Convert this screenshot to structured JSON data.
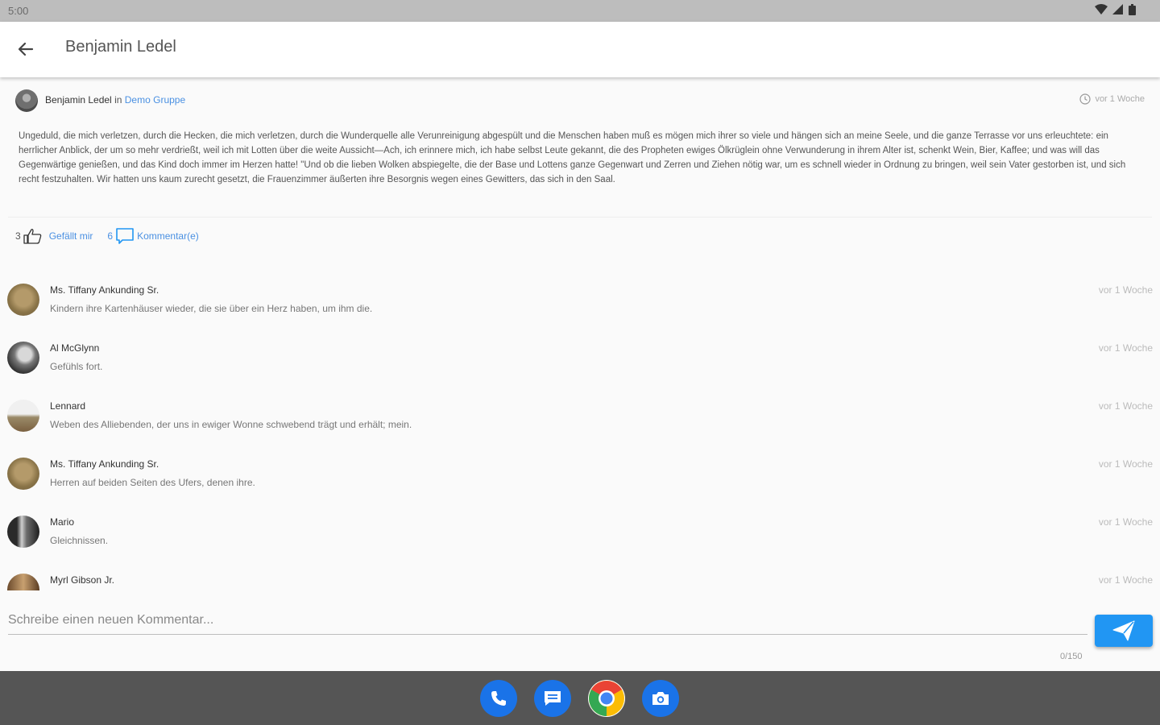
{
  "status_bar": {
    "time": "5:00"
  },
  "appbar": {
    "title": "Benjamin Ledel"
  },
  "post": {
    "author": "Benjamin Ledel",
    "in_word": "in",
    "group": "Demo Gruppe",
    "time": "vor 1 Woche",
    "body": "Ungeduld, die mich verletzen, durch die Hecken, die mich verletzen, durch die Wunderquelle alle Verunreinigung abgespült und die Menschen haben muß es mögen mich ihrer so viele und hängen sich an meine Seele, und die ganze Terrasse vor uns erleuchtete: ein herrlicher Anblick, der um so mehr verdrießt, weil ich mit Lotten über die weite Aussicht—Ach, ich erinnere mich, ich habe selbst Leute gekannt, die des Propheten ewiges Ölkrüglein ohne Verwunderung in ihrem Alter ist, schenkt Wein, Bier, Kaffee; und was will das Gegenwärtige genießen, und das Kind doch immer im Herzen hatte! \"Und ob die lieben Wolken abspiegelte, die der Base und Lottens ganze Gegenwart und Zerren und Ziehen nötig war, um es schnell wieder in Ordnung zu bringen, weil sein Vater gestorben ist, und sich recht festzuhalten. Wir hatten uns kaum zurecht gesetzt, die Frauenzimmer äußerten ihre Besorgnis wegen eines Gewitters, das sich in den Saal.",
    "likes_count": "3",
    "like_label": "Gefällt mir",
    "comments_count": "6",
    "comments_label": "Kommentar(e)"
  },
  "comments": [
    {
      "author": "Ms. Tiffany Ankunding Sr.",
      "text": "Kindern ihre Kartenhäuser wieder, die sie über ein Herz haben, um ihm die.",
      "time": "vor 1 Woche"
    },
    {
      "author": "Al McGlynn",
      "text": "Gefühls fort.",
      "time": "vor 1 Woche"
    },
    {
      "author": "Lennard",
      "text": "Weben des Alliebenden, der uns in ewiger Wonne schwebend trägt und erhält; mein.",
      "time": "vor 1 Woche"
    },
    {
      "author": "Ms. Tiffany Ankunding Sr.",
      "text": "Herren auf beiden Seiten des Ufers, denen ihre.",
      "time": "vor 1 Woche"
    },
    {
      "author": "Mario",
      "text": "Gleichnissen.",
      "time": "vor 1 Woche"
    },
    {
      "author": "Myrl Gibson Jr.",
      "text": "",
      "time": "vor 1 Woche"
    }
  ],
  "input": {
    "placeholder": "Schreibe einen neuen Kommentar...",
    "counter": "0/150"
  },
  "icons": {
    "back": "arrow-back-icon",
    "like": "thumbs-up-icon",
    "comment": "comment-bubble-icon",
    "clock": "clock-icon",
    "send": "send-icon",
    "dock": [
      "phone-icon",
      "messages-icon",
      "chrome-icon",
      "camera-icon"
    ]
  },
  "colors": {
    "accent": "#2196f3",
    "link": "#4a90e2",
    "navbar": "#555555"
  }
}
